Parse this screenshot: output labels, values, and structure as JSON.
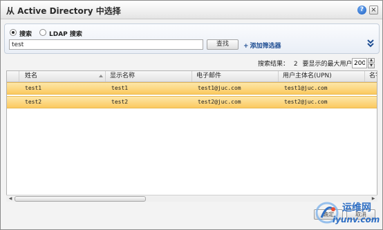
{
  "window": {
    "title": "从 Active Directory 中选择",
    "help_label": "?",
    "close_label": "×"
  },
  "search": {
    "mode_search_label": "搜索",
    "mode_ldap_label": "LDAP 搜索",
    "query_value": "test",
    "find_label": "查找",
    "add_filter_label": "添加筛选器"
  },
  "results": {
    "summary_label": "搜索结果：",
    "count": "2",
    "max_label": "要显示的最大用户数：",
    "max_value": "200"
  },
  "table": {
    "columns": [
      "姓名",
      "显示名称",
      "电子邮件",
      "用户主体名(UPN)",
      "名字"
    ],
    "rows": [
      [
        "test1",
        "test1",
        "test1@juc.com",
        "test1@juc.com"
      ],
      [
        "test2",
        "test2",
        "test2@juc.com",
        "test2@juc.com"
      ]
    ]
  },
  "footer": {
    "ok_label": "确定",
    "cancel_label": "取消"
  },
  "watermark": {
    "name": "运维网",
    "url": "iyunv.com"
  },
  "icons": {
    "help": "help-icon",
    "close": "close-icon",
    "add": "plus-icon",
    "expand": "double-chevron-down-icon",
    "sort": "sort-ascending-icon",
    "logo": "iyunv-logo-icon"
  },
  "colors": {
    "row_highlight": "#fbc95f",
    "link": "#1f4e93",
    "watermark": "#2f6fc4"
  }
}
